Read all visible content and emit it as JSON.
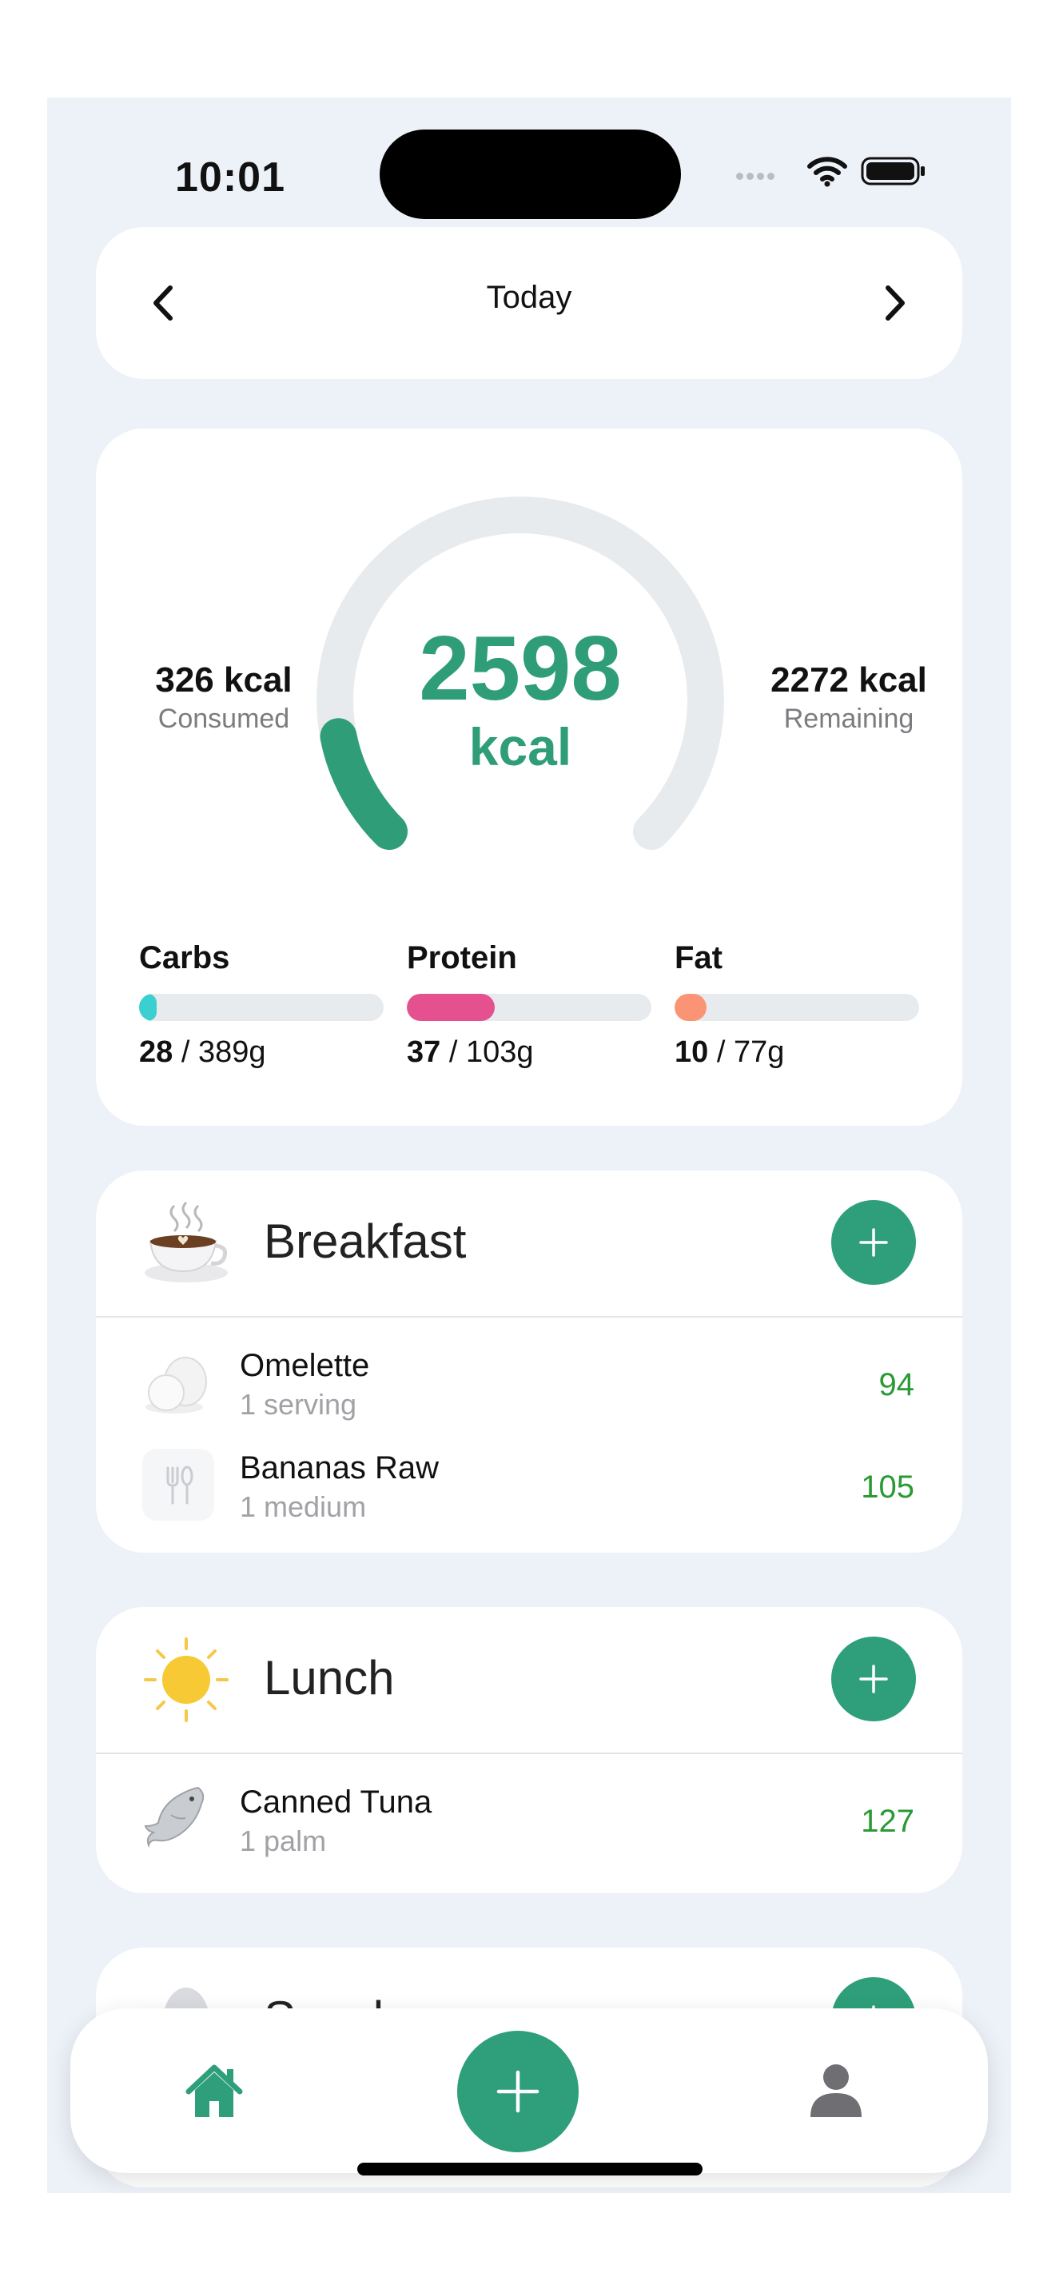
{
  "status": {
    "time": "10:01"
  },
  "date_nav": {
    "label": "Today",
    "prev_icon": "chevron-left-icon",
    "next_icon": "chevron-right-icon"
  },
  "summary": {
    "goal_value": "2598",
    "goal_unit": "kcal",
    "consumed_value": "326 kcal",
    "consumed_label": "Consumed",
    "remaining_value": "2272 kcal",
    "remaining_label": "Remaining",
    "progress_fraction": 0.125,
    "accent_color": "#2f9e78",
    "macros": [
      {
        "name": "Carbs",
        "current": "28",
        "target": " / 389g",
        "fraction": 0.072,
        "color": "#3ccfd0"
      },
      {
        "name": "Protein",
        "current": "37",
        "target": " / 103g",
        "fraction": 0.359,
        "color": "#e5508e"
      },
      {
        "name": "Fat",
        "current": "10",
        "target": " / 77g",
        "fraction": 0.13,
        "color": "#fb9475"
      }
    ]
  },
  "meals": [
    {
      "title": "Breakfast",
      "icon": "coffee-cup-icon",
      "items": [
        {
          "name": "Omelette",
          "portion": "1 serving",
          "kcal": "94",
          "icon": "egg-icon"
        },
        {
          "name": "Bananas Raw",
          "portion": "1 medium",
          "kcal": "105",
          "icon": "utensils-icon"
        }
      ]
    },
    {
      "title": "Lunch",
      "icon": "sun-icon",
      "items": [
        {
          "name": "Canned Tuna",
          "portion": "1 palm",
          "kcal": "127",
          "icon": "fish-icon"
        }
      ]
    },
    {
      "title": "Snacks",
      "icon": "snack-icon",
      "items": []
    }
  ],
  "tabbar": {
    "home_icon": "home-icon",
    "add_icon": "plus-icon",
    "profile_icon": "person-icon"
  }
}
